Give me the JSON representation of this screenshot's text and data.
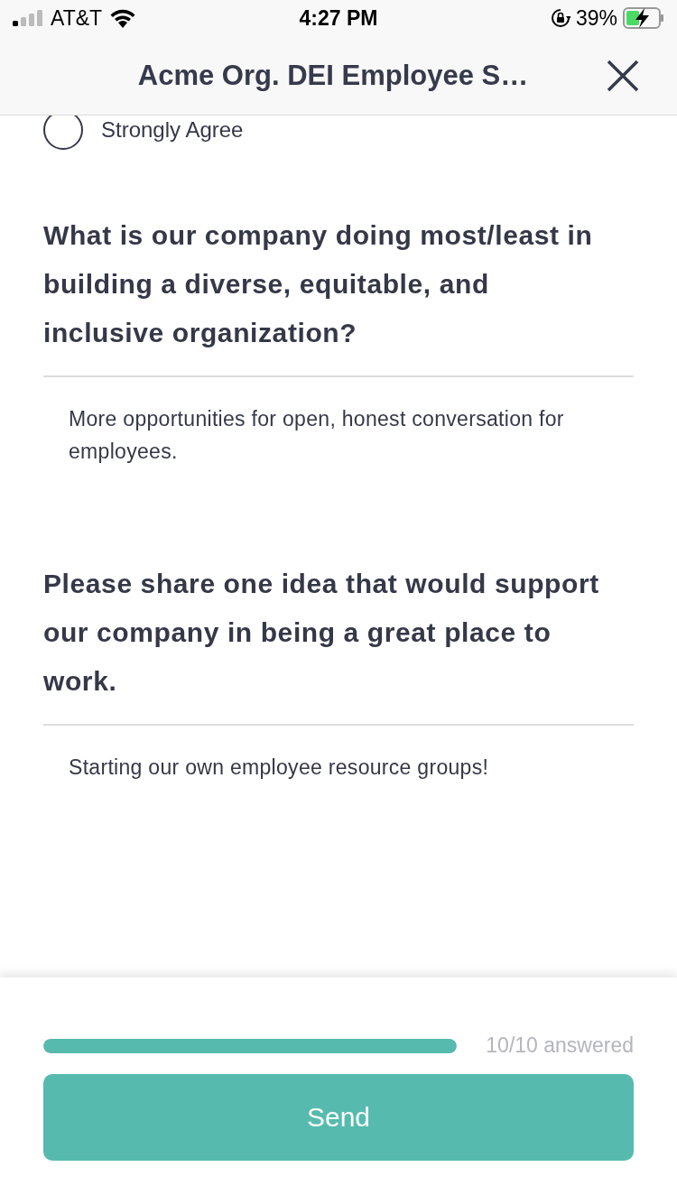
{
  "status_bar": {
    "carrier": "AT&T",
    "time": "4:27 PM",
    "battery": "39%"
  },
  "header": {
    "title": "Acme Org. DEI Employee S…"
  },
  "partial_option": {
    "label": "Strongly Agree",
    "selected": false
  },
  "questions": [
    {
      "text": "What is our company doing most/least in building a diverse, equitable, and inclusive organization?",
      "answer": "More opportunities for open, honest conversation for employees."
    },
    {
      "text": "Please share one idea that would support our company in being a great place to work.",
      "answer": "Starting our own employee resource groups!"
    }
  ],
  "progress": {
    "level": 1,
    "reading": "10/10 answered"
  },
  "send_button": {
    "label": "Send"
  }
}
